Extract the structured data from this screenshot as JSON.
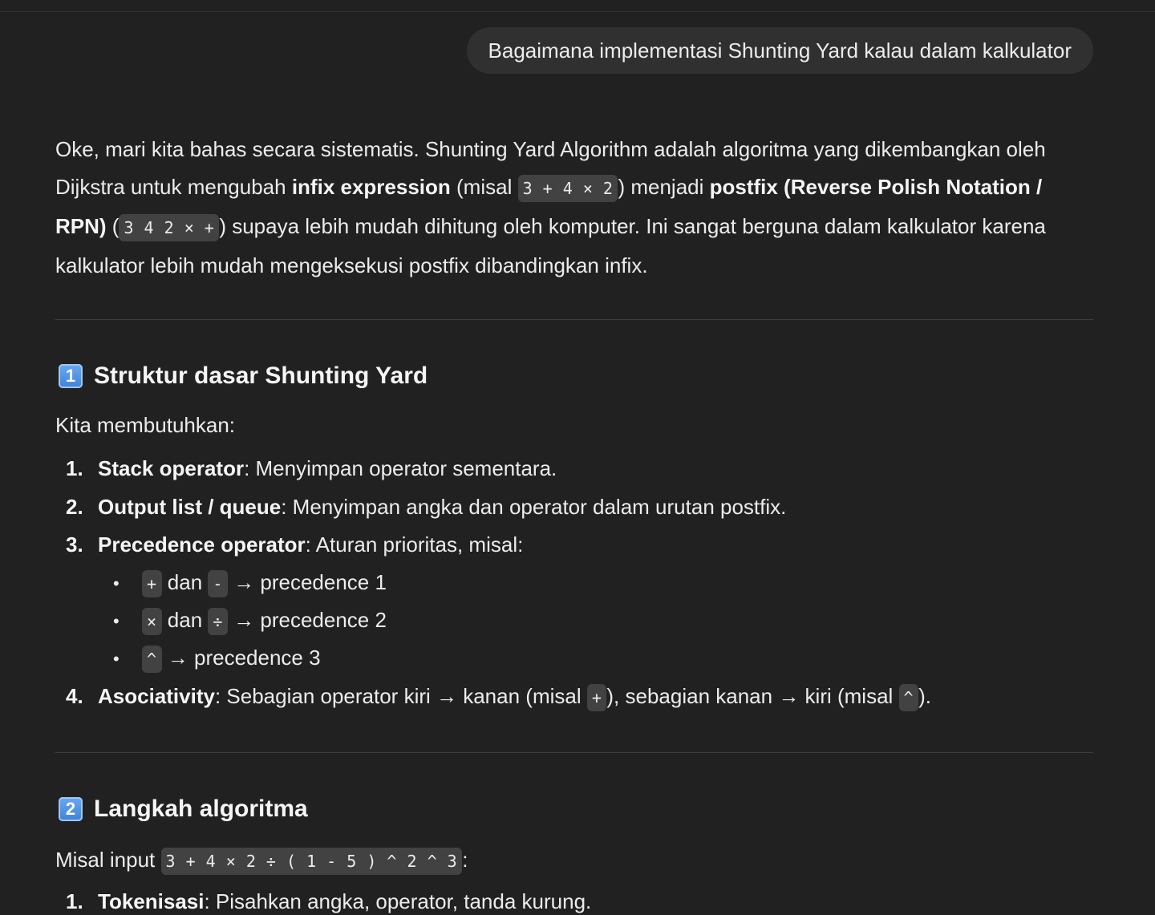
{
  "user_message": "Bagaimana implementasi Shunting Yard kalau dalam kalkulator",
  "intro": {
    "t1": "Oke, mari kita bahas secara sistematis. Shunting Yard Algorithm adalah algoritma yang dikembangkan oleh Dijkstra untuk mengubah ",
    "b1": "infix expression",
    "t2": " (misal ",
    "c1": "3 + 4 × 2",
    "t3": ") menjadi ",
    "b2": "postfix (Reverse Polish Notation / RPN)",
    "t4": " (",
    "c2": "3 4 2 × +",
    "t5": ") supaya lebih mudah dihitung oleh komputer. Ini sangat berguna dalam kalkulator karena kalkulator lebih mudah mengeksekusi postfix dibandingkan infix."
  },
  "section1": {
    "badge": "1",
    "title": "Struktur dasar Shunting Yard",
    "lead": "Kita membutuhkan:",
    "items": [
      {
        "num": "1.",
        "bold": "Stack operator",
        "text": ": Menyimpan operator sementara."
      },
      {
        "num": "2.",
        "bold": "Output list / queue",
        "text": ": Menyimpan angka dan operator dalam urutan postfix."
      },
      {
        "num": "3.",
        "bold": "Precedence operator",
        "text": ": Aturan prioritas, misal:"
      },
      {
        "num": "4.",
        "bold": "Asociativity",
        "t1": ": Sebagian operator kiri → kanan (misal ",
        "c1": "+",
        "t2": "), sebagian kanan → kiri (misal ",
        "c2": "^",
        "t3": ")."
      }
    ],
    "bullets": [
      {
        "c1": "+",
        "mid": " dan ",
        "c2": "-",
        "rest": " → precedence 1"
      },
      {
        "c1": "×",
        "mid": " dan ",
        "c2": "÷",
        "rest": " → precedence 2"
      },
      {
        "c1": "^",
        "rest": " → precedence 3"
      }
    ]
  },
  "section2": {
    "badge": "2",
    "title": "Langkah algoritma",
    "lead_text": "Misal input ",
    "lead_code": "3 + 4 × 2 ÷ ( 1 - 5 ) ^ 2 ^ 3",
    "lead_end": ":",
    "items": [
      {
        "num": "1.",
        "bold": "Tokenisasi",
        "text": ": Pisahkan angka, operator, tanda kurung."
      }
    ]
  },
  "colors": {
    "background": "#212121",
    "bubble": "#303030",
    "code_bg": "#424242",
    "text": "#ececec"
  }
}
